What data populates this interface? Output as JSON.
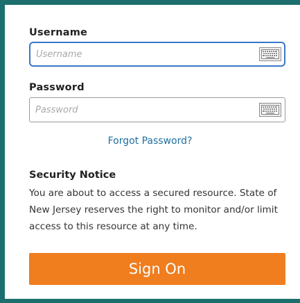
{
  "username": {
    "label": "Username",
    "placeholder": "Username",
    "value": ""
  },
  "password": {
    "label": "Password",
    "placeholder": "Password",
    "value": ""
  },
  "icons": {
    "keyboard": "keyboard-icon"
  },
  "forgot_password": "Forgot Password?",
  "security_notice": {
    "title": "Security Notice",
    "body": "You are about to access a secured resource. State of New Jersey reserves the right to monitor and/or limit access to this resource at any time."
  },
  "sign_on_label": "Sign On",
  "colors": {
    "frame": "#1c6f6c",
    "focus_border": "#3a76c7",
    "link": "#1d6fa0",
    "button": "#f07d1e"
  }
}
